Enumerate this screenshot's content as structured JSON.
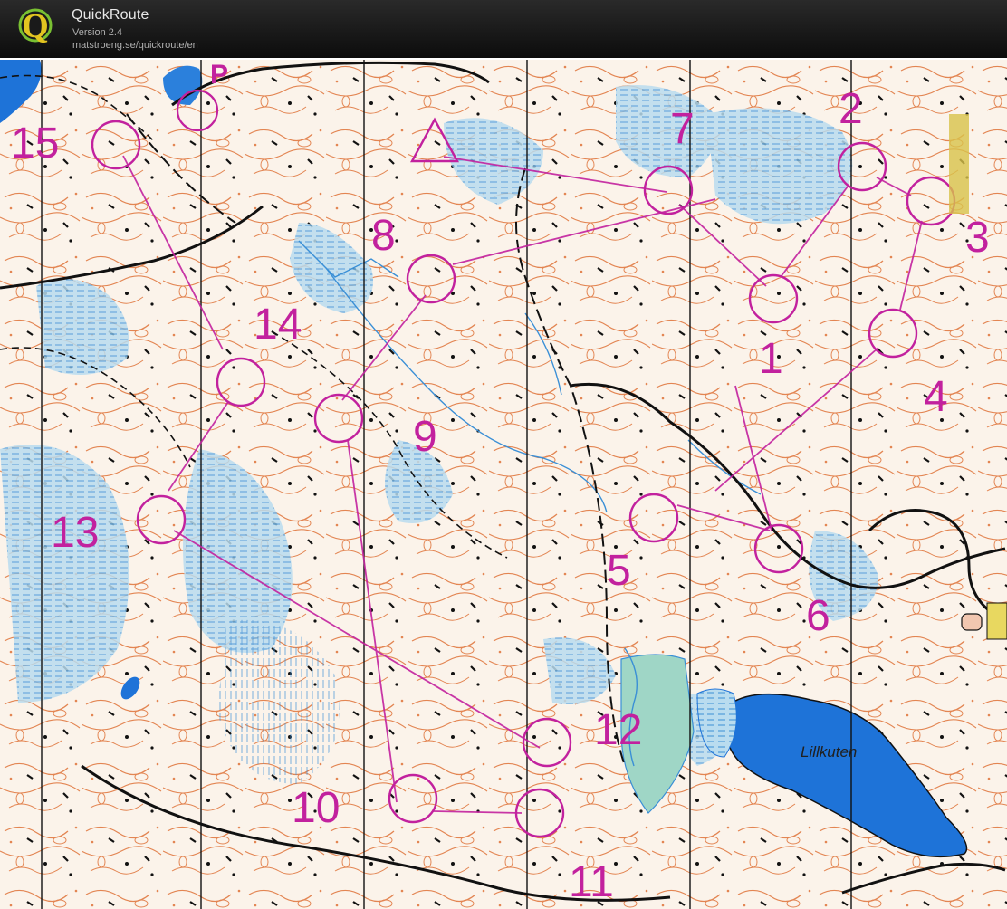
{
  "app": {
    "title": "QuickRoute",
    "version": "Version 2.4",
    "url": "matstroeng.se/quickroute/en",
    "logo_letter": "Q"
  },
  "map": {
    "start_symbol": "triangle",
    "parking_label": "P",
    "lake_label": "Lillkuten",
    "course_color": "#c2219e",
    "water_color": "#1e73d8",
    "marsh_color": "#8ec6e6",
    "contour_color": "#e07a4a",
    "road_color": "#111111",
    "controls": [
      {
        "number": "1"
      },
      {
        "number": "2"
      },
      {
        "number": "3"
      },
      {
        "number": "4"
      },
      {
        "number": "5"
      },
      {
        "number": "6"
      },
      {
        "number": "7"
      },
      {
        "number": "8"
      },
      {
        "number": "9"
      },
      {
        "number": "10"
      },
      {
        "number": "11"
      },
      {
        "number": "12"
      },
      {
        "number": "13"
      },
      {
        "number": "14"
      },
      {
        "number": "15"
      }
    ]
  }
}
